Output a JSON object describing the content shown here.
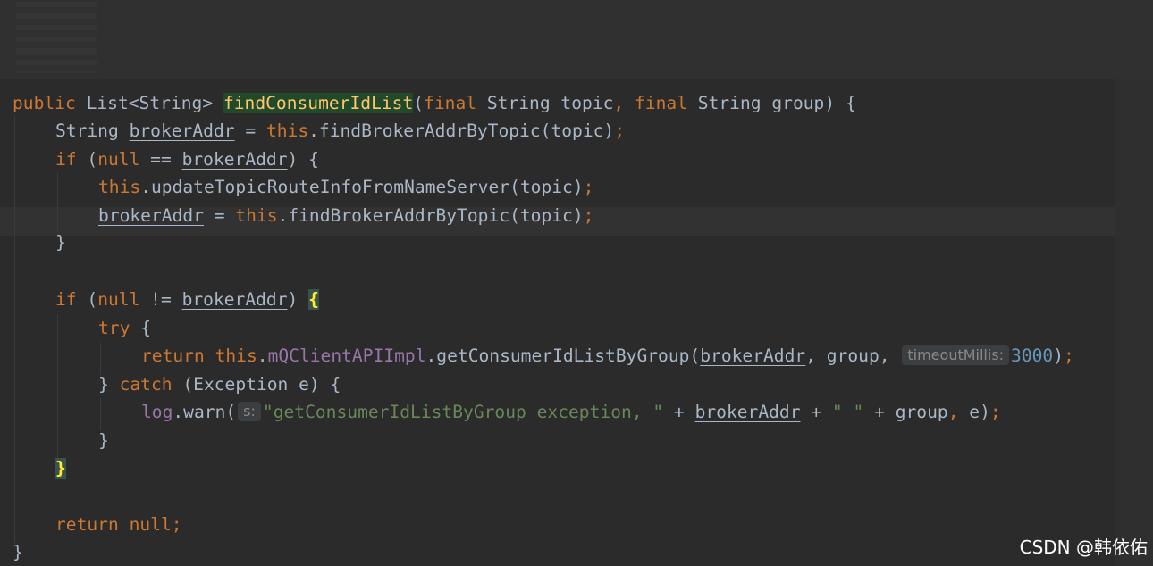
{
  "code": {
    "l1": {
      "mod": "public ",
      "ret": "List<String> ",
      "fn": "findConsumerIdList",
      "p1": "(",
      "kw1": "final ",
      "a1": "String topic",
      "c1": ", ",
      "kw2": "final ",
      "a2": "String group) {"
    },
    "l2": {
      "t1": "String ",
      "v1": "brokerAddr",
      "t2": " = ",
      "kw": "this",
      "t3": ".findBrokerAddrByTopic(topic)",
      "t4": ";"
    },
    "l3": {
      "kw": "if ",
      "t1": "(",
      "kw2": "null",
      "t2": " == ",
      "v1": "brokerAddr",
      "t3": ") {"
    },
    "l4": {
      "kw": "this",
      "t1": ".updateTopicRouteInfoFromNameServer(topic)",
      "t2": ";"
    },
    "l5": {
      "v1": "brokerAddr",
      "t1": " = ",
      "kw": "this",
      "t2": ".findBrokerAddrByTopic(topic)",
      "t3": ";"
    },
    "l6": {
      "t1": "}"
    },
    "l8": {
      "kw": "if ",
      "t1": "(",
      "kw2": "null",
      "t2": " != ",
      "v1": "brokerAddr",
      "t3": ") ",
      "br": "{"
    },
    "l9": {
      "kw": "try ",
      "t1": "{"
    },
    "l10": {
      "kw": "return ",
      "kw2": "this",
      "t1": ".",
      "fld": "mQClientAPIImpl",
      "t2": ".getConsumerIdListByGroup(",
      "v1": "brokerAddr",
      "t3": ", group, ",
      "hint": "timeoutMillis:",
      "num": "3000",
      "t4": ")",
      "t5": ";"
    },
    "l11": {
      "t1": "} ",
      "kw": "catch ",
      "t2": "(Exception e) {"
    },
    "l12": {
      "fld": "log",
      "t1": ".warn(",
      "hint": "s:",
      "str": "\"getConsumerIdListByGroup exception, \"",
      "t2": " + ",
      "v1": "brokerAddr",
      "t3": " + ",
      "str2": "\" \"",
      "t4": " + group",
      "t5": ", ",
      "t6": "e)",
      "t7": ";"
    },
    "l13": {
      "t1": "}"
    },
    "l14": {
      "br": "}"
    },
    "l16": {
      "kw": "return ",
      "kw2": "null",
      "t1": ";"
    },
    "l17": {
      "t1": "}"
    }
  },
  "watermark": "CSDN @韩依佑",
  "colors": {
    "keyword": "#cc7832",
    "method_decl": "#ffc66d",
    "field": "#9876aa",
    "string": "#6a8759",
    "number": "#6897bb",
    "text": "#a9b7c6",
    "background": "#2b2b2b"
  }
}
